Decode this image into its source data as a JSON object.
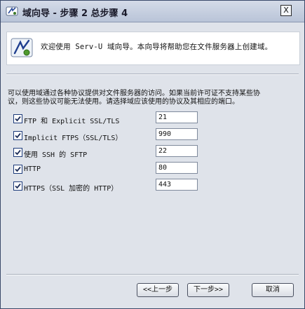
{
  "window": {
    "title": "域向导 - 步骤 2 总步骤 4",
    "close_label": "X"
  },
  "banner": {
    "text": "欢迎使用 Serv-U 域向导。本向导将帮助您在文件服务器上创建域。"
  },
  "description": {
    "line1": "可以使用域通过各种协议提供对文件服务器的访问。如果当前许可证不支持某些协",
    "line2": "议，则这些协议可能无法使用。请选择域应该使用的协议及其相应的端口。"
  },
  "protocols": [
    {
      "label": "FTP 和 Explicit SSL/TLS",
      "port": "21",
      "checked": true
    },
    {
      "label": "Implicit FTPS（SSL/TLS）",
      "port": "990",
      "checked": true
    },
    {
      "label": "使用 SSH 的 SFTP",
      "port": "22",
      "checked": true
    },
    {
      "label": "HTTP",
      "port": "80",
      "checked": true
    },
    {
      "label": "HTTPS（SSL 加密的 HTTP）",
      "port": "443",
      "checked": true
    }
  ],
  "buttons": {
    "back": "<<上一步",
    "next": "下一步>>",
    "cancel": "取消"
  }
}
